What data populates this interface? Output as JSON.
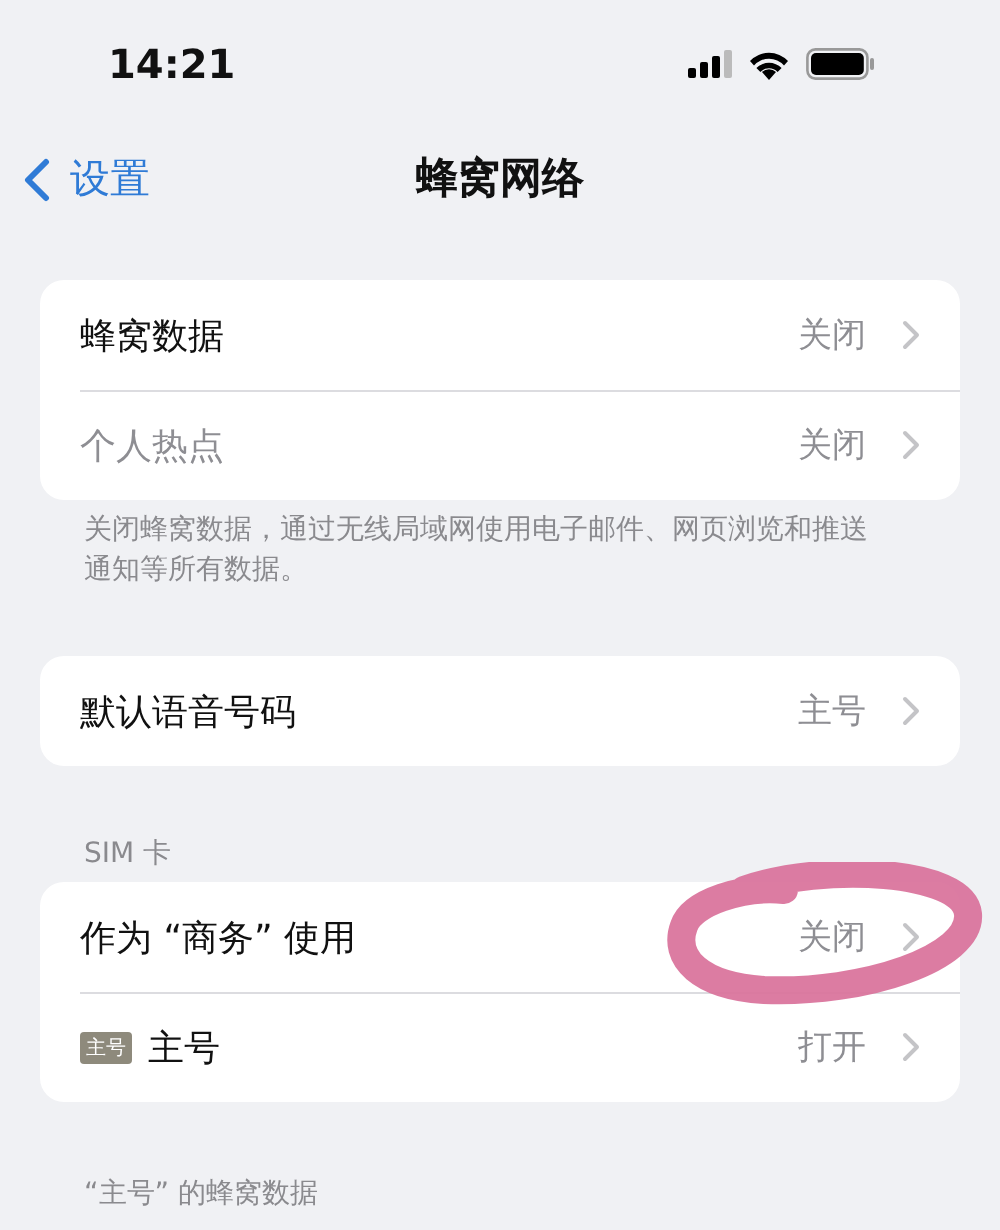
{
  "status_bar": {
    "time": "14:21"
  },
  "nav": {
    "back": "设置",
    "title": "蜂窝网络"
  },
  "sections": [
    {
      "rows": [
        {
          "label": "蜂窝数据",
          "value": "关闭",
          "disabled": false,
          "circled": false
        },
        {
          "label": "个人热点",
          "value": "关闭",
          "disabled": true,
          "circled": false
        }
      ],
      "footer": "关闭蜂窝数据，通过无线局域网使用电子邮件、网页浏览和推送通知等所有数据。"
    },
    {
      "rows": [
        {
          "label": "默认语音号码",
          "value": "主号",
          "disabled": false,
          "circled": false
        }
      ]
    },
    {
      "header": "SIM 卡",
      "rows": [
        {
          "label": "作为 “商务” 使用",
          "value": "关闭",
          "disabled": false,
          "circled": true
        },
        {
          "badge": "主号",
          "label": "主号",
          "value": "打开",
          "disabled": false,
          "circled": false
        }
      ]
    },
    {
      "header": "“主号” 的蜂窝数据"
    }
  ]
}
